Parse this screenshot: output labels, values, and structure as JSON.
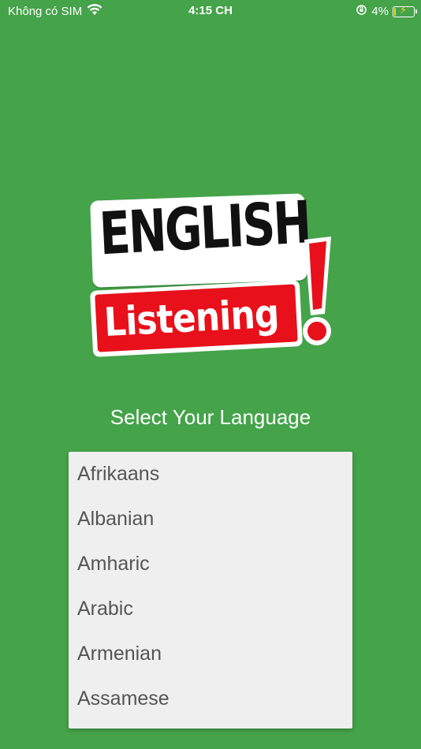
{
  "status_bar": {
    "carrier": "Không có SIM",
    "time": "4:15 CH",
    "battery_percent": "4%",
    "battery_level": 0.04,
    "icons": [
      "wifi-icon",
      "orientation-lock-icon",
      "battery-charging-icon"
    ]
  },
  "logo": {
    "word1": "ENGLISH",
    "word2": "Listening",
    "colors": {
      "red": "#e8101a",
      "black": "#111111",
      "white": "#ffffff"
    }
  },
  "heading": "Select Your Language",
  "languages": [
    "Afrikaans",
    "Albanian",
    "Amharic",
    "Arabic",
    "Armenian",
    "Assamese"
  ],
  "colors": {
    "background": "#45a34a",
    "list_bg": "#efefef",
    "list_text": "#555555"
  }
}
